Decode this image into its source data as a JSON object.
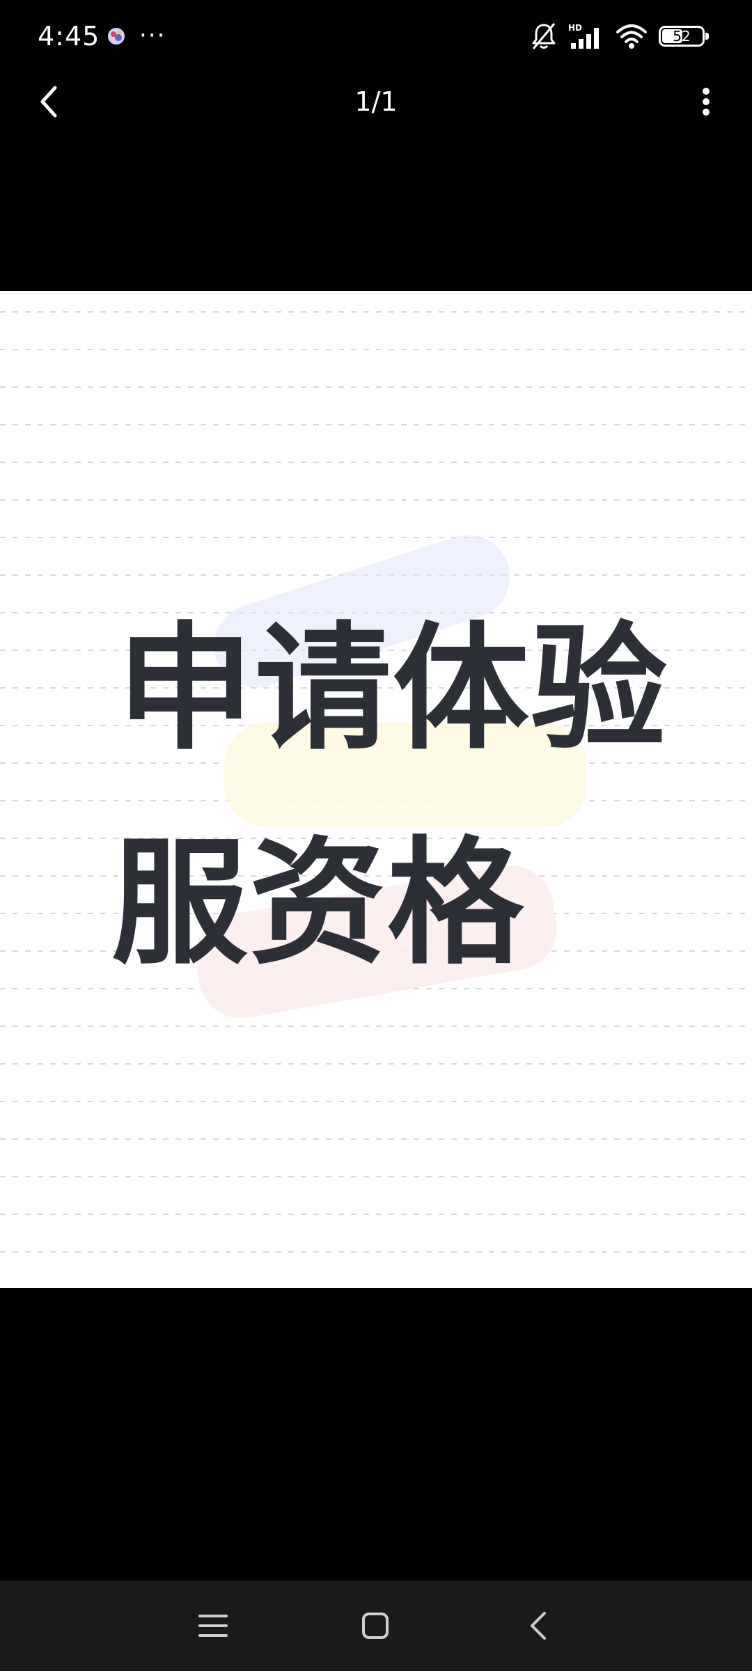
{
  "status_bar": {
    "time": "4:45",
    "notification_icon": "app-notification-icon",
    "more_icon": "more-dots-icon",
    "more_text": "···",
    "icons": [
      "silent-bell-icon",
      "hd-signal-icon",
      "wifi-icon",
      "battery-icon"
    ],
    "signal_label": "HD",
    "battery_level": "52",
    "battery_fraction": 0.52
  },
  "app_bar": {
    "back_icon": "chevron-left-icon",
    "page_indicator": "1/1",
    "menu_icon": "vertical-dots-icon"
  },
  "image": {
    "line1": "申请体验",
    "line2": "服资格"
  },
  "nav_bar": {
    "recents_icon": "hamburger-icon",
    "home_icon": "square-icon",
    "back_icon": "back-chevron-icon"
  },
  "colors": {
    "background": "#000000",
    "image_background": "#ffffff",
    "headline_text": "#2d2f36",
    "nav_bar": "#1a1a1a"
  }
}
